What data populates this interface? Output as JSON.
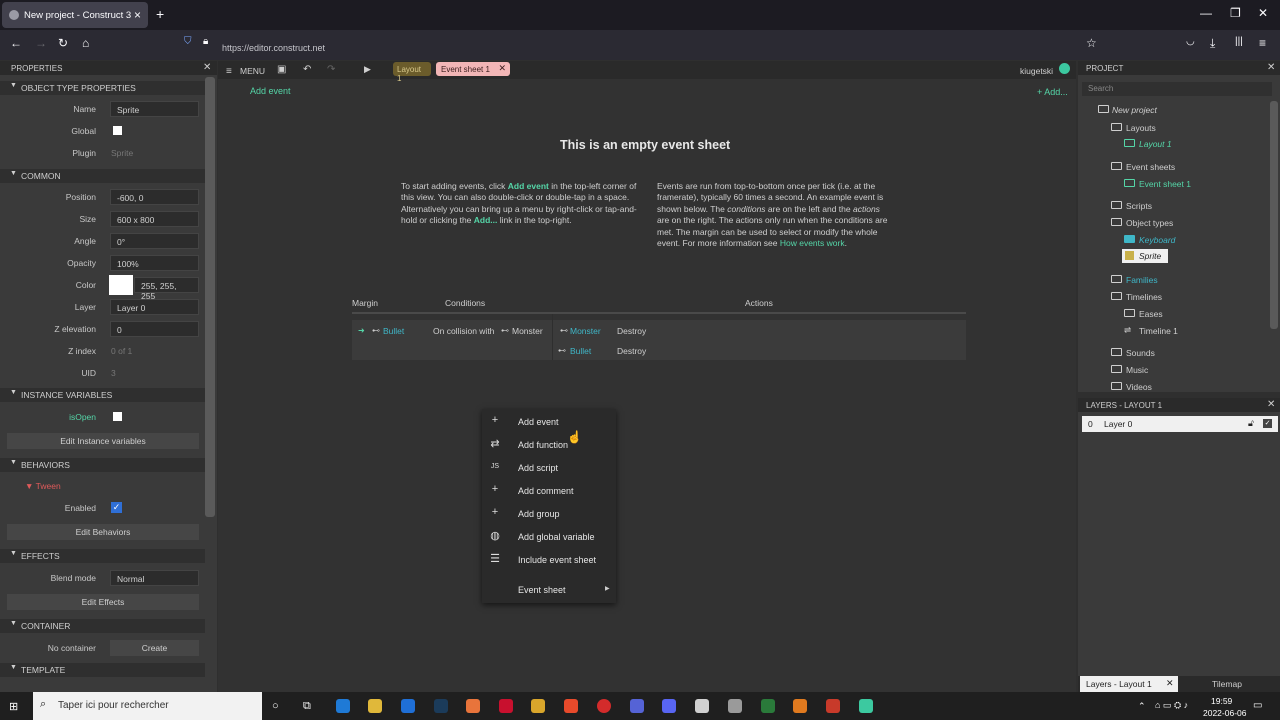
{
  "browser": {
    "tab_title": "New project - Construct 3",
    "url": "https://editor.construct.net"
  },
  "properties": {
    "title": "PROPERTIES",
    "sections": {
      "object_type": "OBJECT TYPE PROPERTIES",
      "common": "COMMON",
      "instance_vars": "INSTANCE VARIABLES",
      "behaviors": "BEHAVIORS",
      "effects": "EFFECTS",
      "container": "CONTAINER",
      "template": "TEMPLATE"
    },
    "labels": {
      "name": "Name",
      "global": "Global",
      "plugin": "Plugin",
      "position": "Position",
      "size": "Size",
      "angle": "Angle",
      "opacity": "Opacity",
      "color": "Color",
      "layer": "Layer",
      "z_elevation": "Z elevation",
      "z_index": "Z index",
      "uid": "UID",
      "is_open": "isOpen",
      "tween": "Tween",
      "enabled": "Enabled",
      "blend_mode": "Blend mode",
      "no_container": "No container"
    },
    "values": {
      "name": "Sprite",
      "plugin": "Sprite",
      "position": "-600, 0",
      "size": "600 x 800",
      "angle": "0°",
      "opacity": "100%",
      "color": "255, 255, 255",
      "layer": "Layer 0",
      "z_elevation": "0",
      "z_index": "0 of 1",
      "uid": "3",
      "blend_mode": "Normal"
    },
    "buttons": {
      "edit_instance_vars": "Edit Instance variables",
      "edit_behaviors": "Edit Behaviors",
      "edit_effects": "Edit Effects",
      "create": "Create"
    }
  },
  "toolbar": {
    "menu": "MENU",
    "tab_layout": "Layout 1",
    "tab_eventsheet": "Event sheet 1",
    "user": "kiugetski"
  },
  "eventsheet": {
    "add_event": "Add event",
    "add_right": "+ Add...",
    "empty_title": "This is an empty event sheet",
    "left_a": "To start adding events, click",
    "left_link": "Add event",
    "left_b": "in the top-left corner of this view. You can also double-click or double-tap in a space. Alternatively you can bring up a menu by right-click or tap-and-hold or clicking the",
    "left_link2": "Add...",
    "left_c": "link in the top-right.",
    "right_a": "Events are run from top-to-bottom once per tick (i.e. at the framerate), typically 60 times a second. An example event is shown below. The",
    "right_em1": "conditions",
    "right_b": "are on the left and the",
    "right_em2": "actions",
    "right_c": "are on the right. The actions only run when the conditions are met. The margin can be used to select or modify the whole event. For more information see",
    "right_link": "How events work",
    "headers": {
      "margin": "Margin",
      "conditions": "Conditions",
      "actions": "Actions"
    },
    "example": {
      "cond_obj": "Bullet",
      "cond_text": "On collision with",
      "cond_target": "Monster",
      "actions": [
        {
          "obj": "Monster",
          "act": "Destroy"
        },
        {
          "obj": "Bullet",
          "act": "Destroy"
        }
      ]
    }
  },
  "context_menu": [
    {
      "icon": "plus-icon",
      "label": "Add event"
    },
    {
      "icon": "function-icon",
      "label": "Add function"
    },
    {
      "icon": "js-icon",
      "label": "Add script"
    },
    {
      "icon": "plus-icon",
      "label": "Add comment"
    },
    {
      "icon": "plus-icon",
      "label": "Add group"
    },
    {
      "icon": "globe-icon",
      "label": "Add global variable"
    },
    {
      "icon": "list-icon",
      "label": "Include event sheet"
    },
    {
      "icon": "",
      "label": "Event sheet"
    }
  ],
  "project": {
    "title": "PROJECT",
    "search_placeholder": "Search",
    "items": {
      "root": "New project",
      "layouts": "Layouts",
      "layout1": "Layout 1",
      "eventsheets": "Event sheets",
      "eventsheet1": "Event sheet 1",
      "scripts": "Scripts",
      "objecttypes": "Object types",
      "keyboard": "Keyboard",
      "sprite": "Sprite",
      "families": "Families",
      "timelines": "Timelines",
      "eases": "Eases",
      "timeline1": "Timeline 1",
      "sounds": "Sounds",
      "music": "Music",
      "videos": "Videos"
    }
  },
  "layers": {
    "title": "LAYERS - LAYOUT 1",
    "row_index": "0",
    "row_name": "Layer 0",
    "tab_layers": "Layers - Layout 1",
    "tab_tilemap": "Tilemap"
  },
  "taskbar": {
    "search_placeholder": "Taper ici pour rechercher",
    "time": "19:59",
    "date": "2022-06-06"
  },
  "colors": {
    "accent_green": "#55d6a8",
    "link_cyan": "#3fb7c8",
    "tween_red": "#e05a5a"
  }
}
